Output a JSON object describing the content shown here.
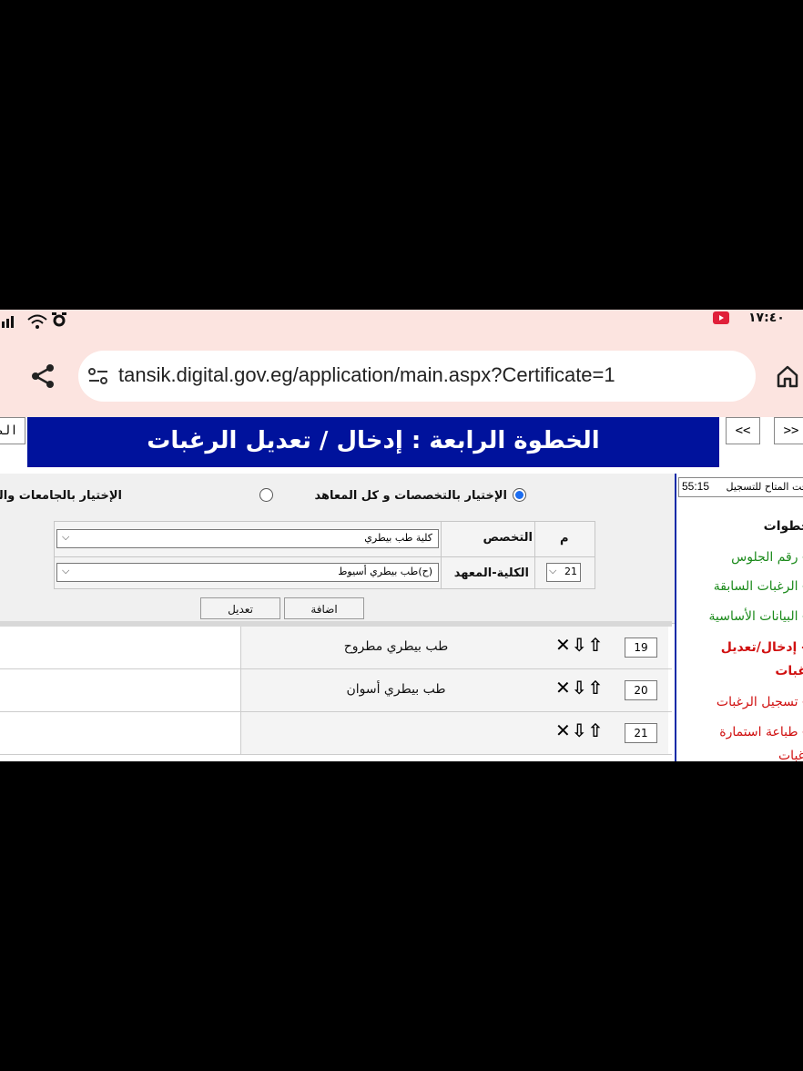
{
  "status_bar": {
    "time": "١٧:٤٠"
  },
  "browser": {
    "url": "tansik.digital.gov.eg/application/main.aspx?Certificate=1"
  },
  "nav": {
    "prev_label": "<<",
    "next_label": ">>",
    "left_edge_label": "الص"
  },
  "banner": {
    "title": "الخطوة الرابعة : إدخال / تعديل الرغبات"
  },
  "options": {
    "by_specialization": "الإختيار بالتخصصات و كل المعاهد",
    "by_university": "الإختيار بالجامعات والمعاهد الجغرافية"
  },
  "form": {
    "col_m": "م",
    "col_specialization": "التخصص",
    "col_faculty": "الكلية-المعهد",
    "specialization_value": "كلية طب بيطري",
    "faculty_value": "(ح)طب بيطري أسيوط",
    "index_value": "21",
    "add_button": "اضافة",
    "edit_button": "تعديل"
  },
  "table": {
    "rows": [
      {
        "num": "19",
        "name": "طب بيطري مطروح"
      },
      {
        "num": "20",
        "name": "طب بيطري أسوان"
      },
      {
        "num": "21",
        "name": ""
      }
    ],
    "controls": "✕⇩⇧"
  },
  "sidebar": {
    "timer_label": "قت المتاح للتسجيل",
    "timer_value": "55:15",
    "heading": "خطوات",
    "items": [
      {
        "label": "- رقم الجلوس",
        "color": "#1b8a1b"
      },
      {
        "label": "- الرغبات السابقة",
        "color": "#1b8a1b"
      },
      {
        "label": "- البيانات الأساسية",
        "color": "#1b8a1b"
      },
      {
        "label": "- إدخال/تعديل",
        "label2": "رغبات",
        "color": "#d01010"
      },
      {
        "label": "- تسجيل الرغبات",
        "color": "#d01010"
      },
      {
        "label": "- طباعة استمارة",
        "label2": "غبات",
        "color": "#d01010"
      }
    ]
  }
}
